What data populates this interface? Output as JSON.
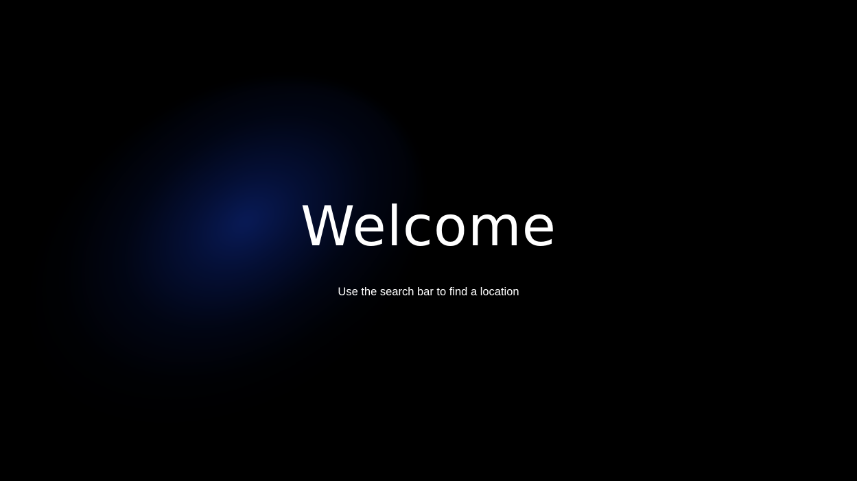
{
  "welcome": {
    "title": "Welcome",
    "subtitle": "Use the search bar to find a location"
  },
  "colors": {
    "background": "#000000",
    "glow": "#091c5c",
    "text": "#ffffff"
  }
}
